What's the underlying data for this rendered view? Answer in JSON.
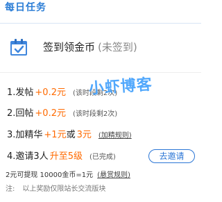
{
  "header": {
    "title": "每日任务"
  },
  "signin": {
    "icon": "calendar-check-icon",
    "label": "签到领金币",
    "status": "(未签到)"
  },
  "tasks": [
    {
      "name": "1.发帖",
      "reward": "+0.2元",
      "note": "(该时段剩2次)"
    },
    {
      "name": "2.回帖",
      "reward": "+0.2元",
      "note": "(该时段剩2次)"
    },
    {
      "name": "3.加精华",
      "reward_prefix": "+1元",
      "reward_joiner": "或",
      "reward_suffix": "3元",
      "note": "(加精规则)"
    },
    {
      "name": "4.邀请3人",
      "reward": "升至5级",
      "note": "(已完成)",
      "button_label": "去邀请"
    }
  ],
  "exchange": {
    "text": "2元可提现 10000金币=1元",
    "link": "(悬赏规则)"
  },
  "footnote": {
    "prefix": "注:",
    "text": "以上奖励仅限站长交流版块"
  },
  "watermark": {
    "text": "小虾博客"
  },
  "colors": {
    "primary": "#2c7ed6",
    "reward": "#ff6a00",
    "watermark": "#3b9dfc"
  }
}
